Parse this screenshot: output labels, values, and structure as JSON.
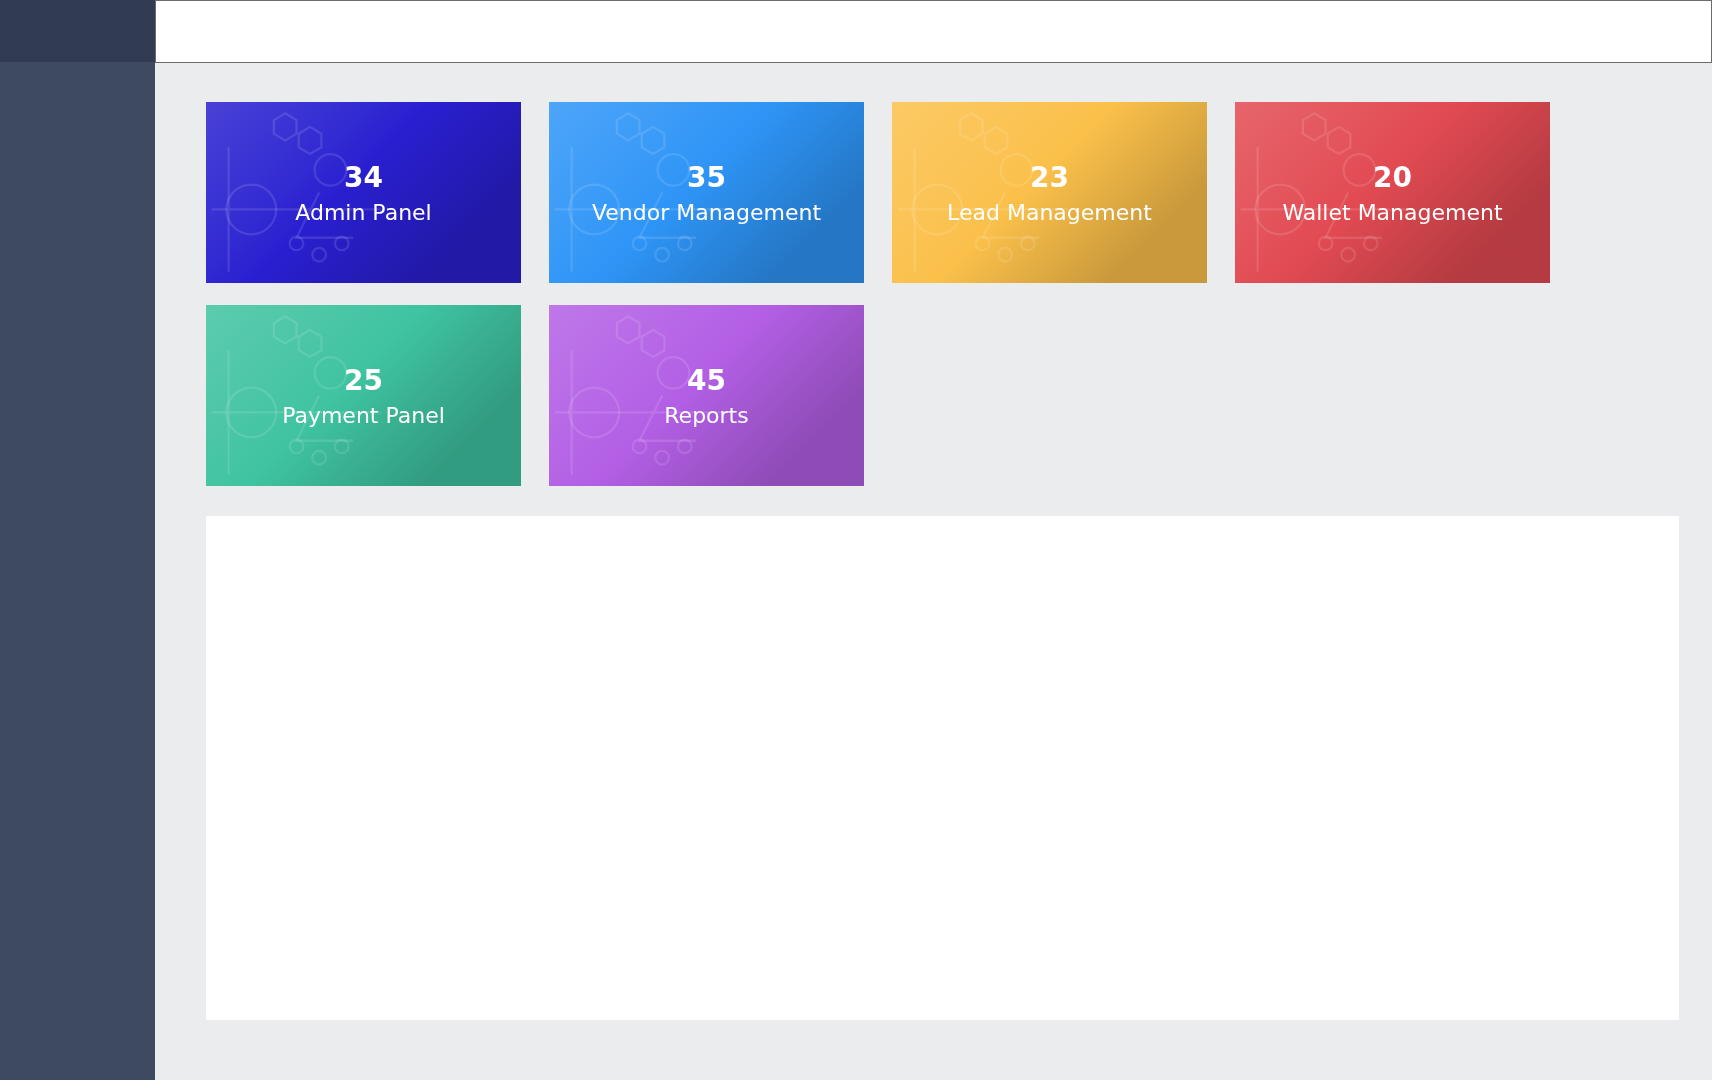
{
  "cards": [
    {
      "count": "34",
      "label": "Admin Panel",
      "color": "#2a1fd0"
    },
    {
      "count": "35",
      "label": "Vendor Management",
      "color": "#2e95f7"
    },
    {
      "count": "23",
      "label": "Lead Management",
      "color": "#fbc04a"
    },
    {
      "count": "20",
      "label": "Wallet Management",
      "color": "#e24a52"
    },
    {
      "count": "25",
      "label": "Payment Panel",
      "color": "#3fc3a0"
    },
    {
      "count": "45",
      "label": "Reports",
      "color": "#b35fe5"
    }
  ]
}
